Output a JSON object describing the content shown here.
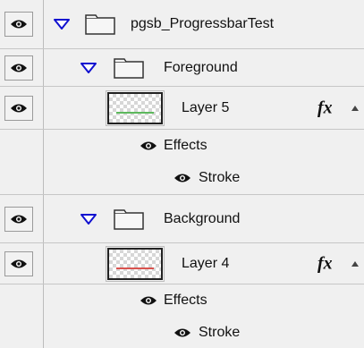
{
  "layers": [
    {
      "type": "group",
      "name": "pgsb_ProgressbarTest",
      "visible": true,
      "expanded": true,
      "indent": 0
    },
    {
      "type": "group",
      "name": "Foreground",
      "visible": true,
      "expanded": true,
      "indent": 1
    },
    {
      "type": "layer",
      "name": "Layer 5",
      "visible": true,
      "thumb_line_color": "#5db85d",
      "has_fx": true,
      "fx_label": "fx"
    },
    {
      "type": "effects",
      "name": "Effects",
      "visible": true
    },
    {
      "type": "effect",
      "name": "Stroke",
      "visible": true
    },
    {
      "type": "group",
      "name": "Background",
      "visible": true,
      "expanded": true,
      "indent": 1
    },
    {
      "type": "layer",
      "name": "Layer 4",
      "visible": true,
      "thumb_line_color": "#d9534f",
      "has_fx": true,
      "fx_label": "fx"
    },
    {
      "type": "effects",
      "name": "Effects",
      "visible": true
    },
    {
      "type": "effect",
      "name": "Stroke",
      "visible": true
    }
  ],
  "colors": {
    "panel_bg": "#f0f0f0",
    "row_border": "#c6c6c6",
    "triangle_fill": "#1010d0"
  },
  "icons": {
    "visibility": "eye-icon",
    "expand": "triangle-down-icon",
    "folder": "folder-icon",
    "effects": "fx-icon"
  }
}
